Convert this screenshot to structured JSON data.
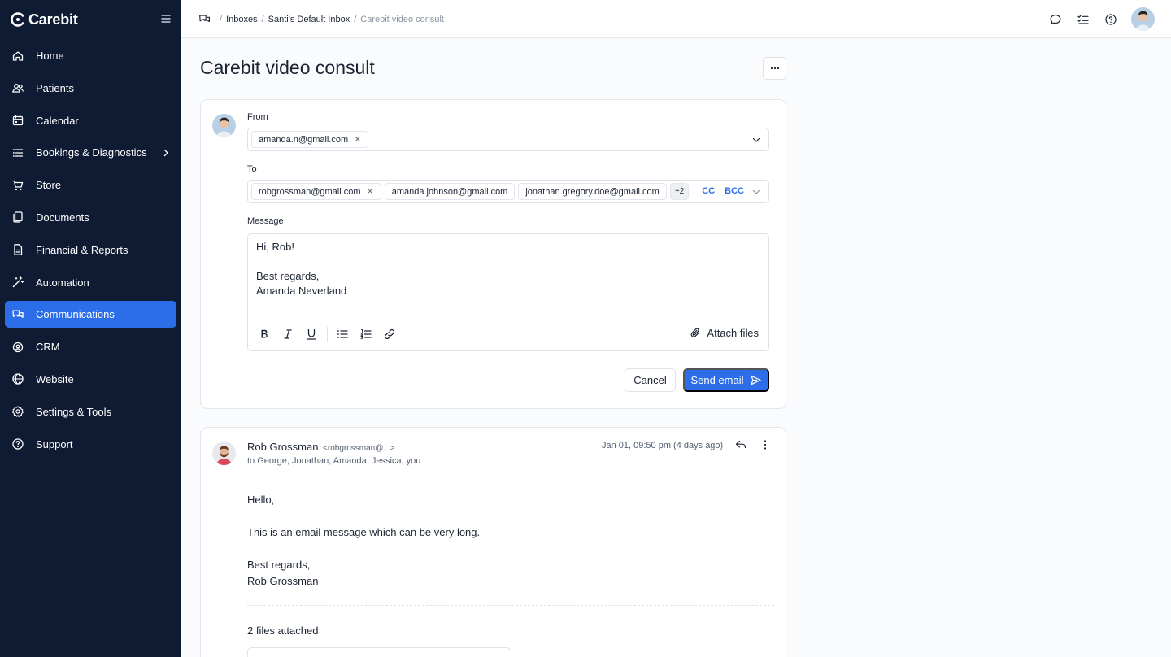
{
  "brand": {
    "name": "Carebit"
  },
  "nav": [
    {
      "label": "Home",
      "icon": "home-icon",
      "active": false
    },
    {
      "label": "Patients",
      "icon": "users-icon",
      "active": false
    },
    {
      "label": "Calendar",
      "icon": "calendar-icon",
      "active": false
    },
    {
      "label": "Bookings & Diagnostics",
      "icon": "list-icon",
      "active": false,
      "chevron": true
    },
    {
      "label": "Store",
      "icon": "cart-icon",
      "active": false
    },
    {
      "label": "Documents",
      "icon": "documents-icon",
      "active": false
    },
    {
      "label": "Financial & Reports",
      "icon": "report-icon",
      "active": false
    },
    {
      "label": "Automation",
      "icon": "wand-icon",
      "active": false
    },
    {
      "label": "Communications",
      "icon": "chat-icon",
      "active": true
    },
    {
      "label": "CRM",
      "icon": "crm-icon",
      "active": false
    },
    {
      "label": "Website",
      "icon": "globe-icon",
      "active": false
    },
    {
      "label": "Settings & Tools",
      "icon": "gear-icon",
      "active": false
    },
    {
      "label": "Support",
      "icon": "help-icon",
      "active": false
    }
  ],
  "breadcrumb": {
    "inboxes": "Inboxes",
    "inbox": "Santi's Default Inbox",
    "current": "Carebit video consult",
    "sep": "/"
  },
  "page": {
    "title": "Carebit video consult"
  },
  "compose": {
    "from_label": "From",
    "from_value": "amanda.n@gmail.com",
    "to_label": "To",
    "to_values": [
      "robgrossman@gmail.com",
      "amanda.johnson@gmail.com",
      "jonathan.gregory.doe@gmail.com"
    ],
    "to_more": "+2",
    "cc": "CC",
    "bcc": "BCC",
    "message_label": "Message",
    "message_lines": [
      "Hi, Rob!",
      "",
      "Best regards,",
      "Amanda Neverland"
    ],
    "attach_label": "Attach files",
    "cancel_label": "Cancel",
    "send_label": "Send email"
  },
  "thread": {
    "sender_name": "Rob Grossman",
    "sender_email": "<robgrossman@...>",
    "recipients": "to George, Jonathan, Amanda, Jessica, you",
    "timestamp": "Jan 01, 09:50 pm (4 days ago)",
    "body": [
      "Hello,",
      "This is an email message which can be very long.",
      "Best regards,",
      "Rob Grossman"
    ],
    "attachments_label": "2 files attached"
  },
  "colors": {
    "sidebar": "#0f1b33",
    "accent": "#2c6ee9"
  }
}
